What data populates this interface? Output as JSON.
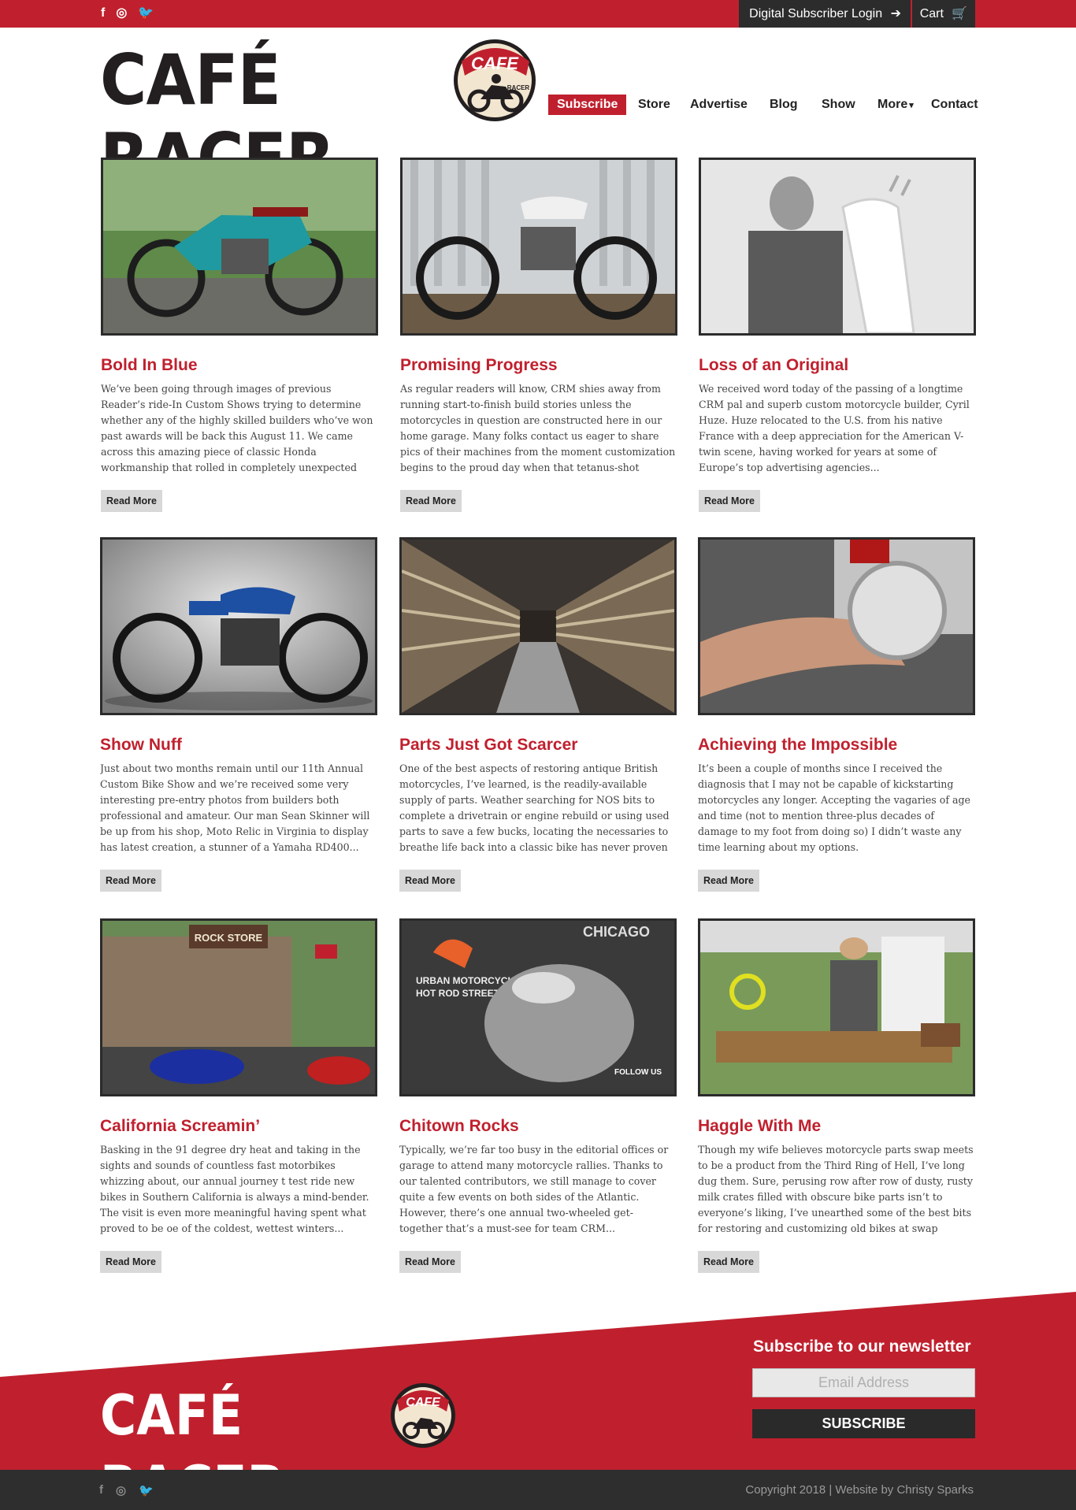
{
  "topbar": {
    "social": [
      {
        "icon": "facebook-icon",
        "glyph": "f"
      },
      {
        "icon": "instagram-icon",
        "glyph": "◎"
      },
      {
        "icon": "twitter-icon",
        "glyph": "🐦"
      }
    ],
    "login_label": "Digital Subscriber Login",
    "login_icon": "➔",
    "cart_label": "Cart",
    "cart_icon": "🛒"
  },
  "logo": {
    "text": "CAFÉ RACER",
    "badge_top": "CAFE",
    "badge_bottom": "RACER"
  },
  "nav": {
    "subscribe": "Subscribe",
    "store": "Store",
    "advertise": "Advertise",
    "blog": "Blog",
    "show": "Show",
    "more": "More",
    "contact": "Contact"
  },
  "articles": [
    {
      "title": "Bold In Blue",
      "excerpt": "We’ve been going through images of previous Reader’s ride-In Custom Shows trying to determine whether any of the highly skilled builders who’ve won past awards will be back this August 11. We came across this amazing piece of classic Honda workmanship that rolled in completely unexpected two years ago.",
      "more": "Read More"
    },
    {
      "title": "Promising Progress",
      "excerpt": "As regular readers will know, CRM shies away from running start-to-finish build stories unless the motorcycles in question are constructed here in our home garage. Many folks contact us eager to share pics of their machines from the moment customization begins to the proud day when that tetanus-shot inducing...",
      "more": "Read More"
    },
    {
      "title": "Loss of an Original",
      "excerpt": "We received word today of the passing of a longtime CRM pal and superb custom motorcycle builder, Cyril Huze. Huze relocated to the U.S. from his native France with a deep appreciation for the American V-twin scene, having worked for years at some of Europe’s top advertising agencies...",
      "more": "Read More"
    },
    {
      "title": "Show Nuff",
      "excerpt": "Just about two months remain until our 11th Annual Custom Bike Show and we’re received some very interesting pre-entry photos from builders both professional and amateur. Our man Sean Skinner will be up from his shop, Moto Relic in Virginia to display has latest creation, a stunner of a Yamaha RD400...",
      "more": "Read More"
    },
    {
      "title": "Parts Just Got Scarcer",
      "excerpt": "One of the best aspects of restoring antique British motorcycles, I’ve learned, is the readily-available supply of parts. Weather searching for NOS bits to complete a drivetrain or engine rebuild or using used parts to save a few bucks, locating the necessaries to breathe life back into a classic bike has never proven terribly difficult.",
      "more": "Read More"
    },
    {
      "title": "Achieving the Impossible",
      "excerpt": "It’s been a couple of months since I received the diagnosis that I may not be capable of kickstarting motorcycles any longer. Accepting the vagaries of age and time (not to mention three-plus decades of damage to my foot from doing so) I didn’t waste any time learning about my options.",
      "more": "Read More"
    },
    {
      "title": "California Screamin’",
      "excerpt": "Basking in the 91 degree dry heat and taking in the sights and sounds of countless fast motorbikes whizzing about, our annual journey t test ride new bikes in Southern California is always a mind-bender. The visit is even more meaningful having spent what proved to be oe of the coldest, wettest winters...",
      "more": "Read More"
    },
    {
      "title": "Chitown Rocks",
      "excerpt": "Typically, we’re far too busy in the editorial offices or garage to attend many motorcycle rallies. Thanks to our talented contributors, we still manage to cover quite a few events on both sides of the Atlantic. However, there’s one annual two-wheeled get-together that’s a must-see for team CRM...",
      "more": "Read More"
    },
    {
      "title": "Haggle With Me",
      "excerpt": "Though my wife believes motorcycle parts swap meets to be a product from the Third Ring of Hell, I’ve long dug them. Sure, perusing row after row of dusty, rusty milk crates filled with obscure bike parts isn’t to everyone’s liking, I’ve unearthed some of the best bits for restoring and customizing old bikes at swap meets.",
      "more": "Read More"
    }
  ],
  "image_text": {
    "rock_store": "ROCK STORE",
    "chicago": "CHICAGO",
    "rally_line1": "URBAN MOTORCYCLE &",
    "rally_line2": "HOT ROD STREET RALLY",
    "follow_us": "FOLLOW US"
  },
  "footer": {
    "logo_text": "CAFÉ RACER",
    "newsletter_title": "Subscribe to our newsletter",
    "email_placeholder": "Email Address",
    "subscribe_button": "SUBSCRIBE",
    "copyright": "Copyright 2018 | Website by Christy Sparks",
    "social": [
      {
        "icon": "facebook-icon",
        "glyph": "f"
      },
      {
        "icon": "instagram-icon",
        "glyph": "◎"
      },
      {
        "icon": "twitter-icon",
        "glyph": "🐦"
      }
    ]
  },
  "colors": {
    "brand_red": "#c0202e",
    "dark": "#2c2c2c"
  }
}
